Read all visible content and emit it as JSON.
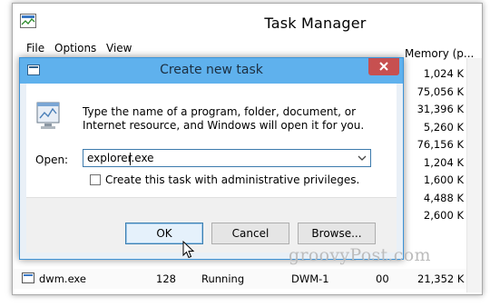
{
  "task_manager": {
    "title": "Task Manager",
    "menu": [
      "File",
      "Options",
      "View"
    ],
    "memory_header": "Memory (p...",
    "memory_values": [
      "1,024 K",
      "75,056 K",
      "31,396 K",
      "5,260 K",
      "76,156 K",
      "1,204 K",
      "1,600 K",
      "4,488 K",
      "2,600 K"
    ],
    "row": {
      "name": "dwm.exe",
      "pid": "128",
      "status": "Running",
      "user": "DWM-1",
      "cpu": "00",
      "memory": "21,352 K"
    }
  },
  "dialog": {
    "title": "Create new task",
    "description": "Type the name of a program, folder, document, or Internet resource, and Windows will open it for you.",
    "open_label": "Open:",
    "open_value": "explorer.exe",
    "checkbox_label": "Create this task with administrative privileges.",
    "buttons": {
      "ok": "OK",
      "cancel": "Cancel",
      "browse": "Browse..."
    }
  },
  "watermark": "groovyPost.com",
  "colors": {
    "dialog_title_bar": "#5fb1ed",
    "close_button": "#c75050",
    "dialog_bg": "#e9f0f7"
  }
}
